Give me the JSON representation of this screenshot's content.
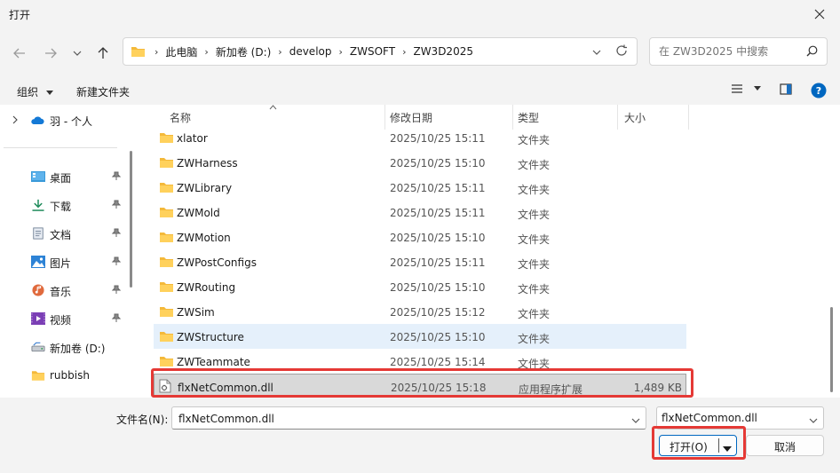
{
  "window": {
    "title": "打开"
  },
  "address": {
    "crumbs": [
      "此电脑",
      "新加卷 (D:)",
      "develop",
      "ZWSOFT",
      "ZW3D2025"
    ]
  },
  "search": {
    "placeholder": "在 ZW3D2025 中搜索"
  },
  "toolbar": {
    "organize_label": "组织",
    "new_folder_label": "新建文件夹"
  },
  "sidebar": {
    "items": [
      {
        "label": "羽 - 个人",
        "icon": "cloud-icon"
      },
      {
        "label": "桌面",
        "icon": "desktop-icon",
        "pinned": true
      },
      {
        "label": "下载",
        "icon": "download-icon",
        "pinned": true
      },
      {
        "label": "文档",
        "icon": "document-icon",
        "pinned": true
      },
      {
        "label": "图片",
        "icon": "picture-icon",
        "pinned": true
      },
      {
        "label": "音乐",
        "icon": "music-icon",
        "pinned": true
      },
      {
        "label": "视频",
        "icon": "video-icon",
        "pinned": true
      },
      {
        "label": "新加卷 (D:)",
        "icon": "drive-icon"
      },
      {
        "label": "rubbish",
        "icon": "folder-icon"
      }
    ]
  },
  "columns": {
    "name": "名称",
    "date": "修改日期",
    "type": "类型",
    "size": "大小"
  },
  "files": [
    {
      "name": "xlator",
      "date": "2025/10/25 15:11",
      "type": "文件夹",
      "size": ""
    },
    {
      "name": "ZWHarness",
      "date": "2025/10/25 15:10",
      "type": "文件夹",
      "size": ""
    },
    {
      "name": "ZWLibrary",
      "date": "2025/10/25 15:11",
      "type": "文件夹",
      "size": ""
    },
    {
      "name": "ZWMold",
      "date": "2025/10/25 15:11",
      "type": "文件夹",
      "size": ""
    },
    {
      "name": "ZWMotion",
      "date": "2025/10/25 15:10",
      "type": "文件夹",
      "size": ""
    },
    {
      "name": "ZWPostConfigs",
      "date": "2025/10/25 15:11",
      "type": "文件夹",
      "size": ""
    },
    {
      "name": "ZWRouting",
      "date": "2025/10/25 15:10",
      "type": "文件夹",
      "size": ""
    },
    {
      "name": "ZWSim",
      "date": "2025/10/25 15:12",
      "type": "文件夹",
      "size": ""
    },
    {
      "name": "ZWStructure",
      "date": "2025/10/25 15:10",
      "type": "文件夹",
      "size": ""
    },
    {
      "name": "ZWTeammate",
      "date": "2025/10/25 15:14",
      "type": "文件夹",
      "size": ""
    },
    {
      "name": "flxNetCommon.dll",
      "date": "2025/10/25 15:18",
      "type": "应用程序扩展",
      "size": "1,489 KB"
    }
  ],
  "footer": {
    "filename_label": "文件名(N):",
    "filename_value": "flxNetCommon.dll",
    "filetype_value": "flxNetCommon.dll",
    "open_label": "打开(O)",
    "cancel_label": "取消"
  },
  "colors": {
    "accent": "#0067c0",
    "highlight": "#e53935",
    "folder": "#f4b93a"
  }
}
